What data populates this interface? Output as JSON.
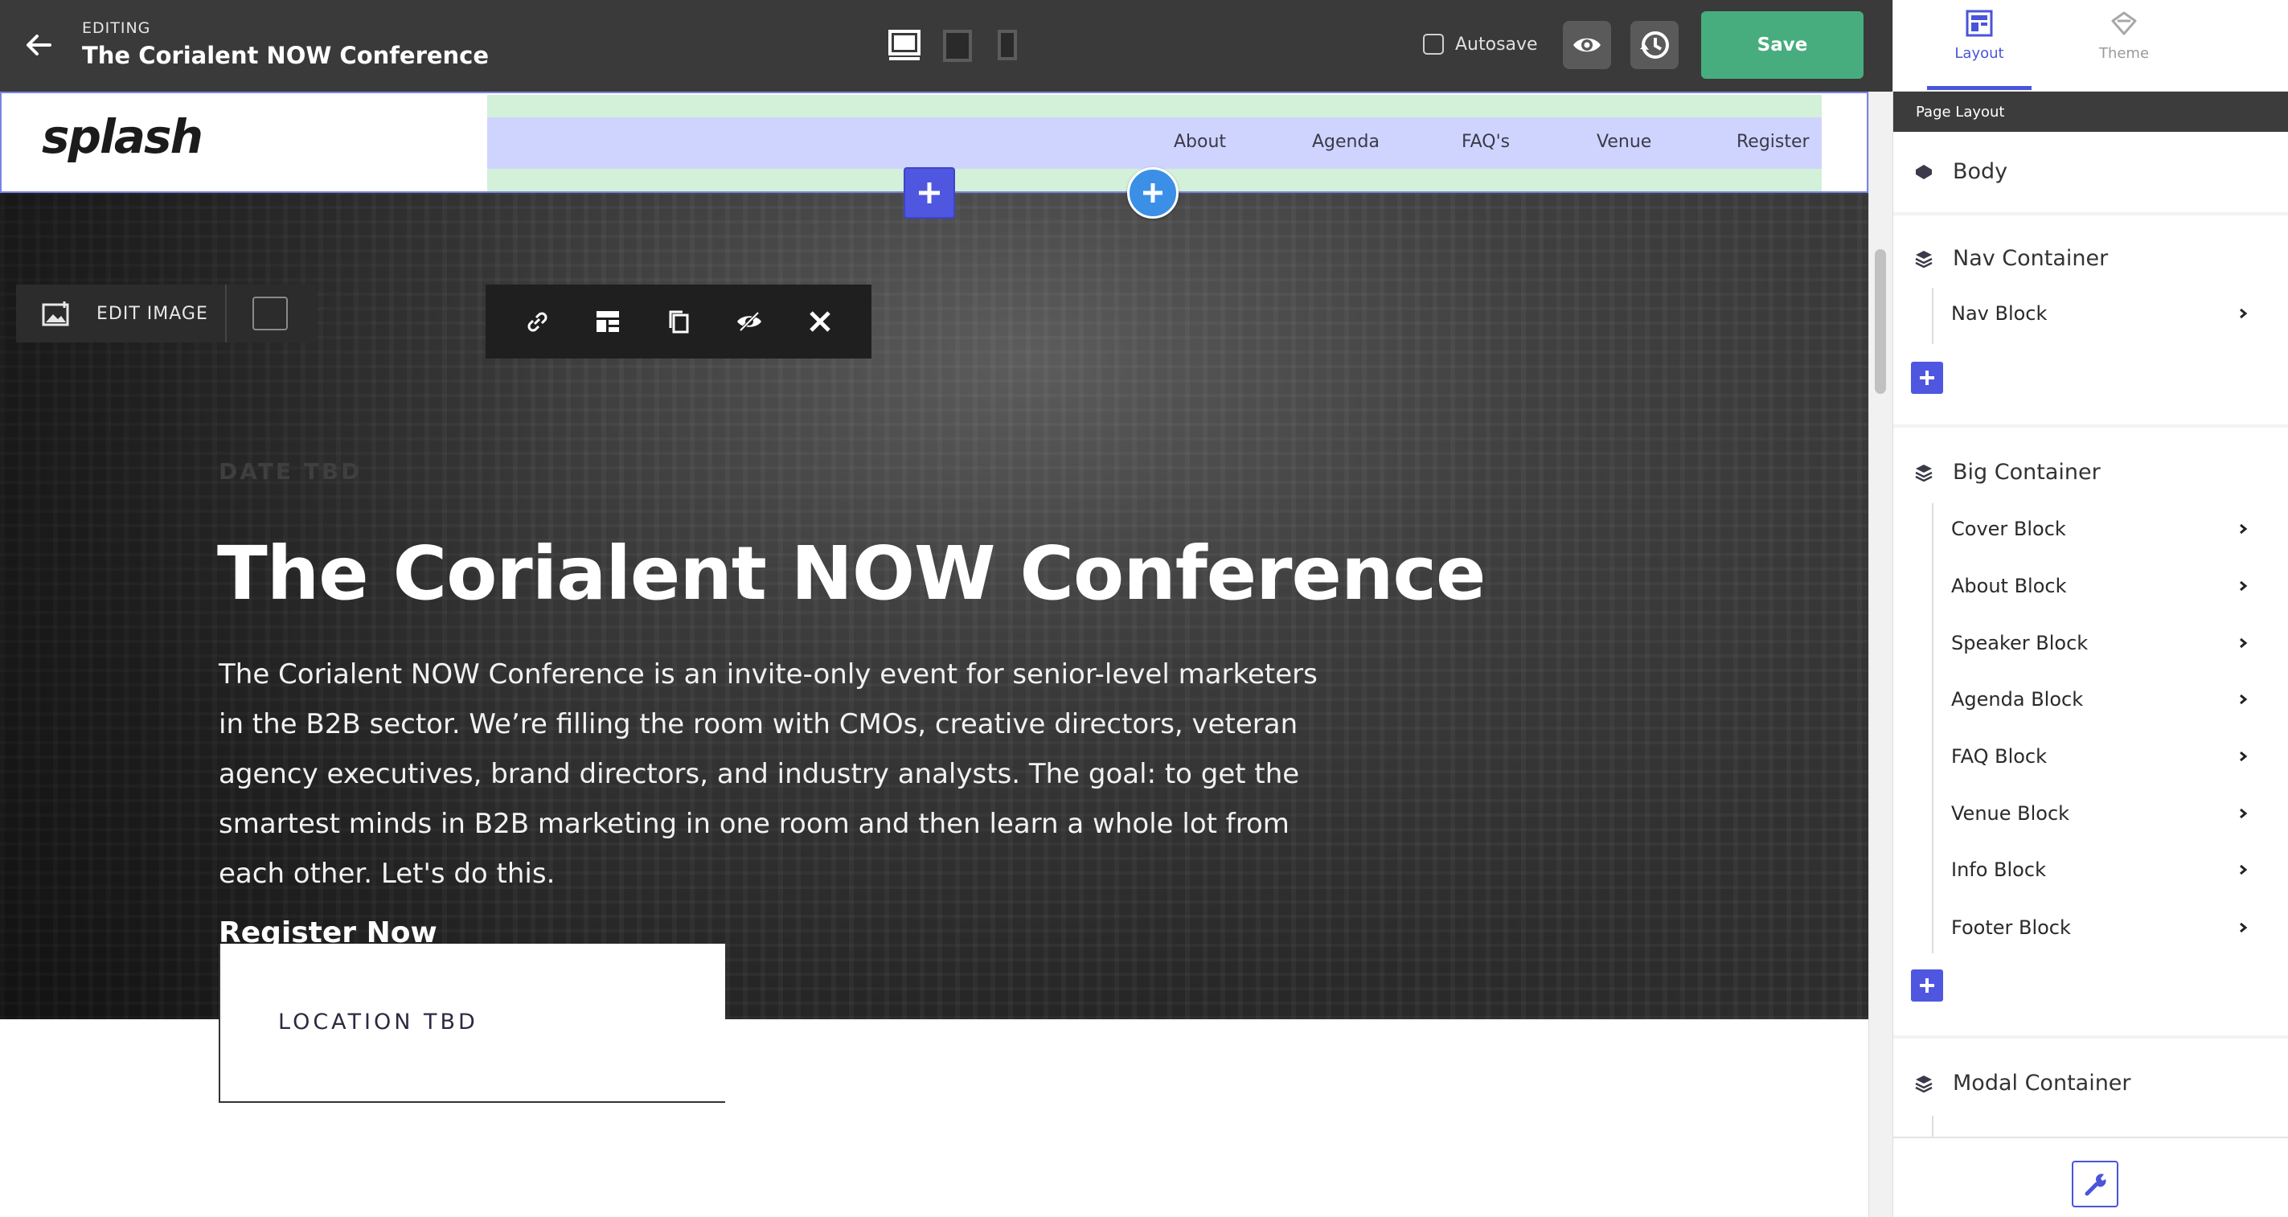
{
  "topbar": {
    "editing_label": "EDITING",
    "doc_title": "The Corialent NOW Conference",
    "autosave_label": "Autosave",
    "save_label": "Save"
  },
  "site": {
    "logo": "splash",
    "nav": [
      "About",
      "Agenda",
      "FAQ's",
      "Venue",
      "Register"
    ]
  },
  "image_toolbar": {
    "edit_image_label": "EDIT IMAGE"
  },
  "hero": {
    "date": "DATE TBD",
    "title": "The Corialent NOW Conference",
    "description": "The Corialent NOW Conference is an invite-only event for senior-level marketers in the B2B sector. We’re filling the room with CMOs, creative directors, veteran agency executives, brand directors, and industry analysts. The goal: to get the smartest minds in B2B marketing in one room and then learn a whole lot from each other. Let's do this.",
    "cta": "Register Now",
    "location": "LOCATION TBD"
  },
  "panel": {
    "tabs": [
      {
        "label": "Layout",
        "icon": "layout-icon"
      },
      {
        "label": "Theme",
        "icon": "theme-icon"
      }
    ],
    "section_header": "Page Layout",
    "body_label": "Body",
    "nav_container": {
      "label": "Nav Container",
      "blocks": [
        "Nav Block"
      ]
    },
    "big_container": {
      "label": "Big Container",
      "blocks": [
        "Cover Block",
        "About Block",
        "Speaker Block",
        "Agenda Block",
        "FAQ Block",
        "Venue Block",
        "Info Block",
        "Footer Block"
      ]
    },
    "modal_container": {
      "label": "Modal Container"
    }
  },
  "colors": {
    "save_green": "#47ad7e",
    "accent_blue": "#4f57e0",
    "topbar_bg": "#3a3a3a"
  }
}
